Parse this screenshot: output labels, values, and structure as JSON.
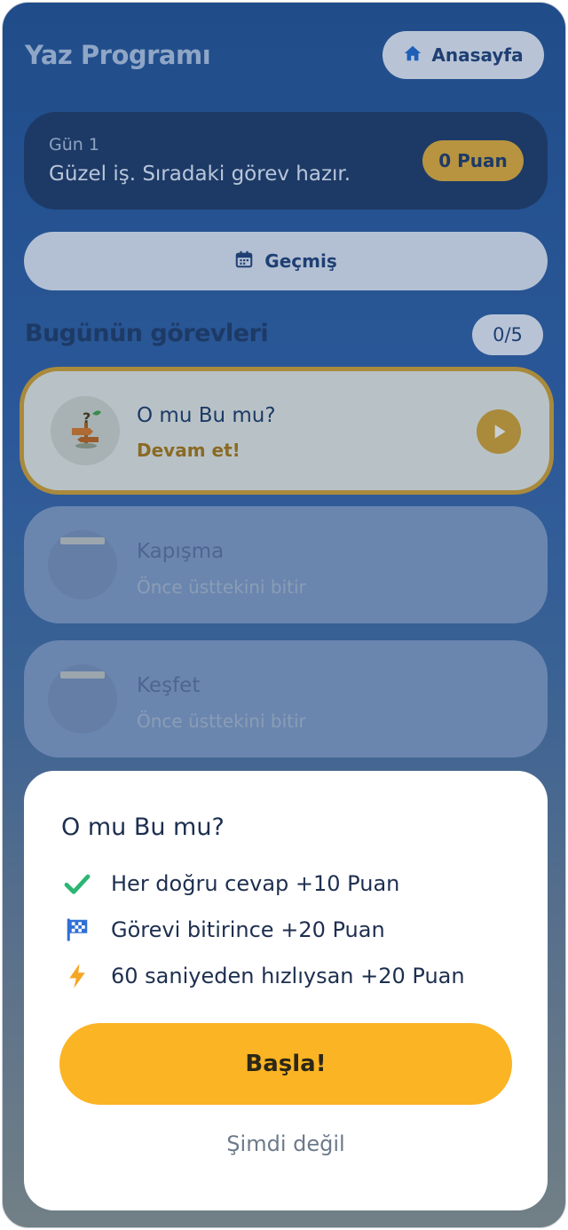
{
  "header": {
    "title": "Yaz Programı",
    "home_label": "Anasayfa"
  },
  "day_card": {
    "day_label": "Gün 1",
    "message": "Güzel iş. Sıradaki görev hazır.",
    "points": "0 Puan"
  },
  "history": {
    "label": "Geçmiş"
  },
  "tasks_section": {
    "title": "Bugünün görevleri",
    "counter": "0/5"
  },
  "tasks": [
    {
      "title": "O mu Bu mu?",
      "subtitle": "Devam et!",
      "state": "active"
    },
    {
      "title": "Kapışma",
      "subtitle": "Önce üsttekini bitir",
      "state": "locked"
    },
    {
      "title": "Keşfet",
      "subtitle": "Önce üsttekini bitir",
      "state": "locked"
    }
  ],
  "sheet": {
    "title": "O mu Bu mu?",
    "rules": [
      {
        "icon": "check-icon",
        "text": "Her doğru cevap +10 Puan"
      },
      {
        "icon": "checkered-flag-icon",
        "text": "Görevi bitirince +20 Puan"
      },
      {
        "icon": "lightning-icon",
        "text": "60 saniyeden hızlıysan +20 Puan"
      }
    ],
    "start_label": "Başla!",
    "later_label": "Şimdi değil"
  },
  "colors": {
    "accent": "#fbb424",
    "navy": "#1d3a66",
    "check": "#2bb673",
    "flag": "#2f6fd6",
    "bolt": "#f5a623"
  }
}
